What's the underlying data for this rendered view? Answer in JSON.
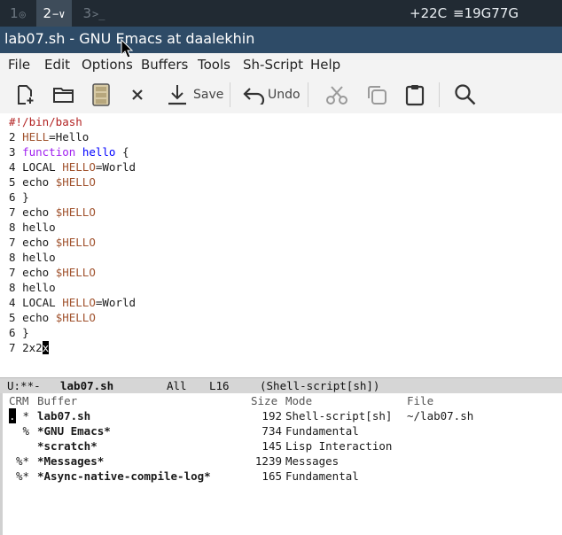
{
  "system_bar": {
    "workspaces": [
      {
        "num": "1",
        "glyph": "◎"
      },
      {
        "num": "2",
        "glyph": "−∨"
      },
      {
        "num": "3",
        "glyph": ">_"
      }
    ],
    "temperature": "+22C",
    "memory": "≡19G77G"
  },
  "window": {
    "title": "lab07.sh - GNU Emacs at daalekhin"
  },
  "menu": [
    "File",
    "Edit",
    "Options",
    "Buffers",
    "Tools",
    "Sh-Script",
    "Help"
  ],
  "toolbar": {
    "save_label": "Save",
    "undo_label": "Undo"
  },
  "editor": {
    "lines": [
      {
        "num": "",
        "parts": [
          {
            "t": "#!/bin/bash",
            "c": "cmt"
          }
        ]
      },
      {
        "num": "2",
        "parts": [
          {
            "t": "HELL",
            "c": "var"
          },
          {
            "t": "=Hello",
            "c": ""
          }
        ]
      },
      {
        "num": "3",
        "parts": [
          {
            "t": "function",
            "c": "kw"
          },
          {
            "t": " ",
            "c": ""
          },
          {
            "t": "hello",
            "c": "fn"
          },
          {
            "t": " {",
            "c": ""
          }
        ]
      },
      {
        "num": "4",
        "parts": [
          {
            "t": "LOCAL ",
            "c": ""
          },
          {
            "t": "HELLO",
            "c": "var"
          },
          {
            "t": "=World",
            "c": ""
          }
        ]
      },
      {
        "num": "5",
        "parts": [
          {
            "t": "echo ",
            "c": ""
          },
          {
            "t": "$HELLO",
            "c": "var"
          }
        ]
      },
      {
        "num": "6",
        "parts": [
          {
            "t": "}",
            "c": ""
          }
        ]
      },
      {
        "num": "7",
        "parts": [
          {
            "t": "echo ",
            "c": ""
          },
          {
            "t": "$HELLO",
            "c": "var"
          }
        ]
      },
      {
        "num": "8",
        "parts": [
          {
            "t": "hello",
            "c": ""
          }
        ]
      },
      {
        "num": "7",
        "parts": [
          {
            "t": "echo ",
            "c": ""
          },
          {
            "t": "$HELLO",
            "c": "var"
          }
        ]
      },
      {
        "num": "8",
        "parts": [
          {
            "t": "hello",
            "c": ""
          }
        ]
      },
      {
        "num": "7",
        "parts": [
          {
            "t": "echo ",
            "c": ""
          },
          {
            "t": "$HELLO",
            "c": "var"
          }
        ]
      },
      {
        "num": "8",
        "parts": [
          {
            "t": "hello",
            "c": ""
          }
        ]
      },
      {
        "num": "4",
        "parts": [
          {
            "t": "LOCAL ",
            "c": ""
          },
          {
            "t": "HELLO",
            "c": "var"
          },
          {
            "t": "=World",
            "c": ""
          }
        ]
      },
      {
        "num": "5",
        "parts": [
          {
            "t": "echo ",
            "c": ""
          },
          {
            "t": "$HELLO",
            "c": "var"
          }
        ]
      },
      {
        "num": "6",
        "parts": [
          {
            "t": "}",
            "c": ""
          }
        ]
      },
      {
        "num": "7",
        "parts": [
          {
            "t": "2x2",
            "c": ""
          },
          {
            "t": "x",
            "c": "cur"
          }
        ]
      }
    ]
  },
  "modeline": {
    "status": "U:**-",
    "buffer": "lab07.sh",
    "position": "All",
    "line": "L16",
    "mode": "(Shell-script[sh])"
  },
  "buffer_list": {
    "headers": {
      "crm": "CRM",
      "buffer": "Buffer",
      "size": "Size",
      "mode": "Mode",
      "file": "File"
    },
    "rows": [
      {
        "crm": ". *",
        "buffer": "lab07.sh",
        "size": "192",
        "mode": "Shell-script[sh]",
        "file": "~/lab07.sh"
      },
      {
        "crm": " %",
        "buffer": "*GNU Emacs*",
        "size": "734",
        "mode": "Fundamental",
        "file": ""
      },
      {
        "crm": "",
        "buffer": "*scratch*",
        "size": "145",
        "mode": "Lisp Interaction",
        "file": ""
      },
      {
        "crm": "%*",
        "buffer": "*Messages*",
        "size": "1239",
        "mode": "Messages",
        "file": ""
      },
      {
        "crm": "%*",
        "buffer": "*Async-native-compile-log*",
        "size": "165",
        "mode": "Fundamental",
        "file": ""
      }
    ]
  },
  "colors": {
    "titlebar": "#2e4b67",
    "system_bar": "#212a33",
    "modeline": "#d6d6d6"
  }
}
